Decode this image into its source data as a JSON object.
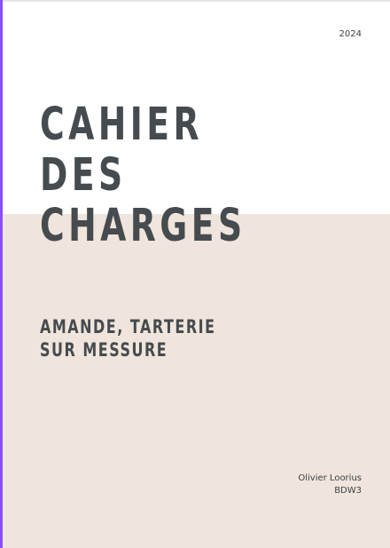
{
  "document": {
    "year": "2024",
    "title_lines": [
      "CAHIER",
      "DES",
      "CHARGES"
    ],
    "subtitle_lines": [
      "AMANDE, TARTERIE",
      "SUR MESSURE"
    ],
    "author": "Olivier Loorius",
    "class_code": "BDW3"
  },
  "colors": {
    "accent": "#8a4dff",
    "panel": "#f0e5dc",
    "text": "#454b4e"
  }
}
